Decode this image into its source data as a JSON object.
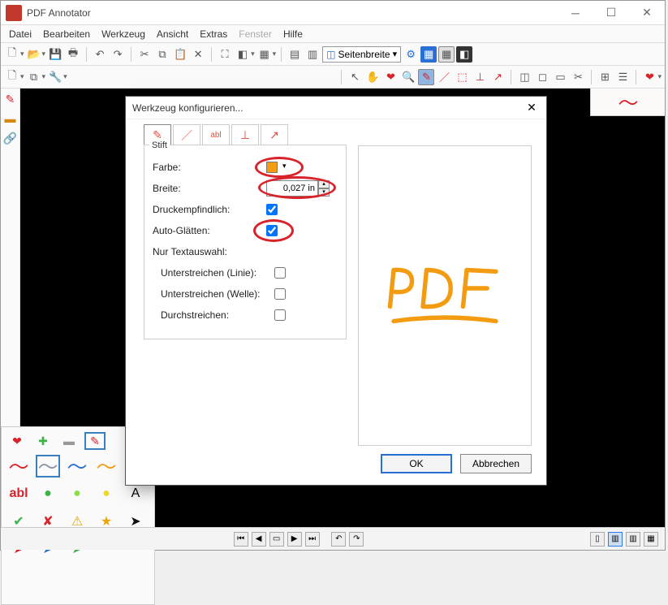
{
  "app": {
    "title": "PDF Annotator"
  },
  "menu": {
    "items": [
      "Datei",
      "Bearbeiten",
      "Werkzeug",
      "Ansicht",
      "Extras",
      "Fenster",
      "Hilfe"
    ],
    "disabled_index": 5
  },
  "toolbar1": {
    "zoom_combo": "Seitenbreite"
  },
  "dialog": {
    "title": "Werkzeug konfigurieren...",
    "tab_active": 0,
    "group_legend": "Stift",
    "labels": {
      "farbe": "Farbe:",
      "breite": "Breite:",
      "druck": "Druckempfindlich:",
      "auto": "Auto-Glätten:",
      "nurtext": "Nur Textauswahl:",
      "unter_linie": "Unterstreichen (Linie):",
      "unter_welle": "Unterstreichen (Welle):",
      "durch": "Durchstreichen:"
    },
    "values": {
      "farbe_hex": "#f39c12",
      "breite": "0,027 in",
      "druck": true,
      "auto": true,
      "unter_linie": false,
      "unter_welle": false,
      "durch": false
    },
    "preview_text": "PDF",
    "buttons": {
      "ok": "OK",
      "cancel": "Abbrechen"
    }
  }
}
